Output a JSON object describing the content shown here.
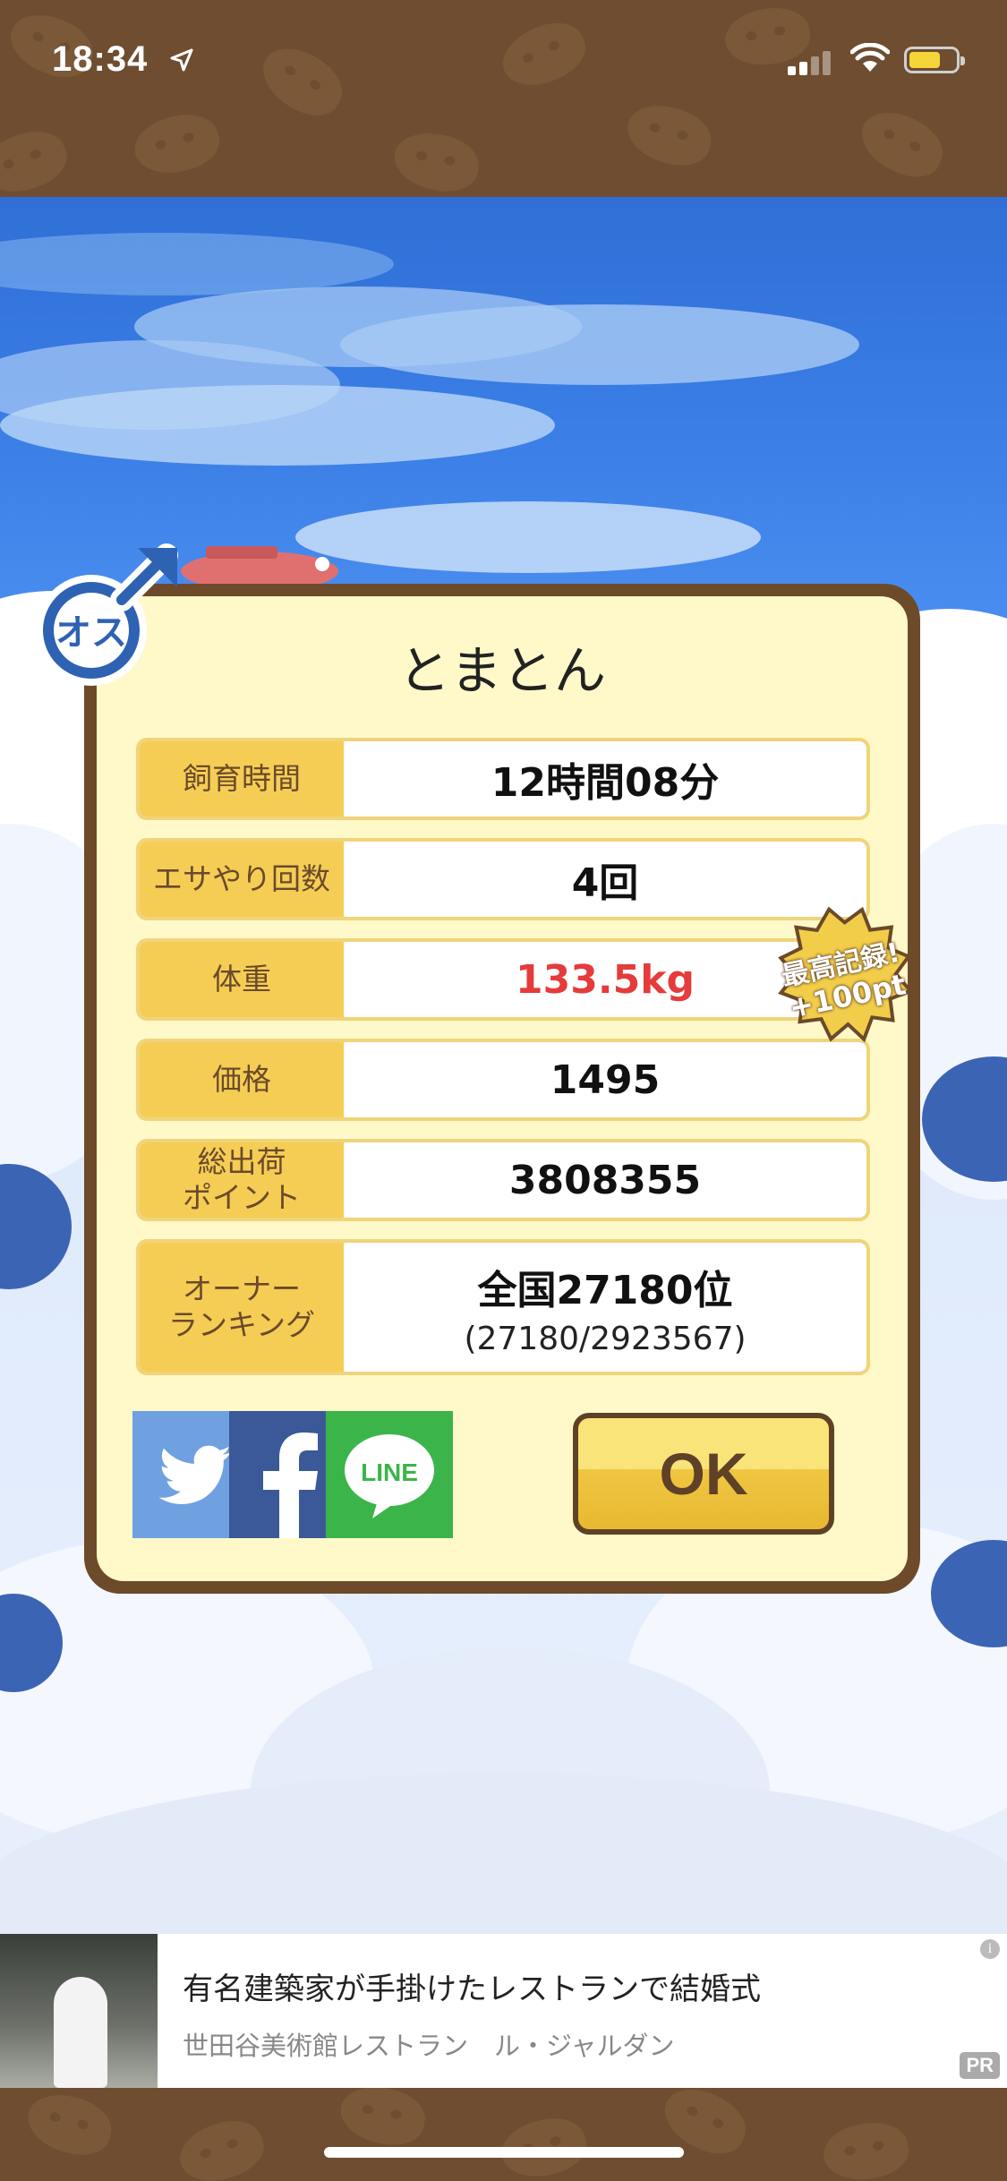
{
  "status_bar": {
    "time": "18:34"
  },
  "pig_panel": {
    "name": "とまとん",
    "rows": [
      {
        "label": "飼育時間",
        "value": "12時間08分"
      },
      {
        "label": "エサやり回数",
        "value": "4回"
      },
      {
        "label": "体重",
        "value": "133.5kg",
        "value_color": "#e53b3b"
      },
      {
        "label": "価格",
        "value": "1495"
      },
      {
        "label": "総出荷\nポイント",
        "value": "3808355"
      },
      {
        "label": "オーナー\nランキング",
        "value": "全国27180位",
        "sub": "(27180/2923567)"
      }
    ],
    "record_badge": {
      "line1": "最高記録!",
      "line2": "+100pt"
    },
    "gender_badge": "オス",
    "share": [
      {
        "name": "twitter",
        "color": "#6fa1e1"
      },
      {
        "name": "facebook",
        "color": "#3b5998",
        "glyph": "f"
      },
      {
        "name": "line",
        "color": "#3bb54a",
        "glyph": "LINE"
      }
    ],
    "ok_label": "OK"
  },
  "ad": {
    "title": "有名建築家が手掛けたレストランで結婚式",
    "subtitle": "世田谷美術館レストラン　ル・ジャルダン",
    "pr_label": "PR",
    "info_label": "i"
  },
  "colors": {
    "accent": "#f5cd55",
    "panel_border": "#6d4a2a",
    "panel_bg": "#fff9c9"
  }
}
